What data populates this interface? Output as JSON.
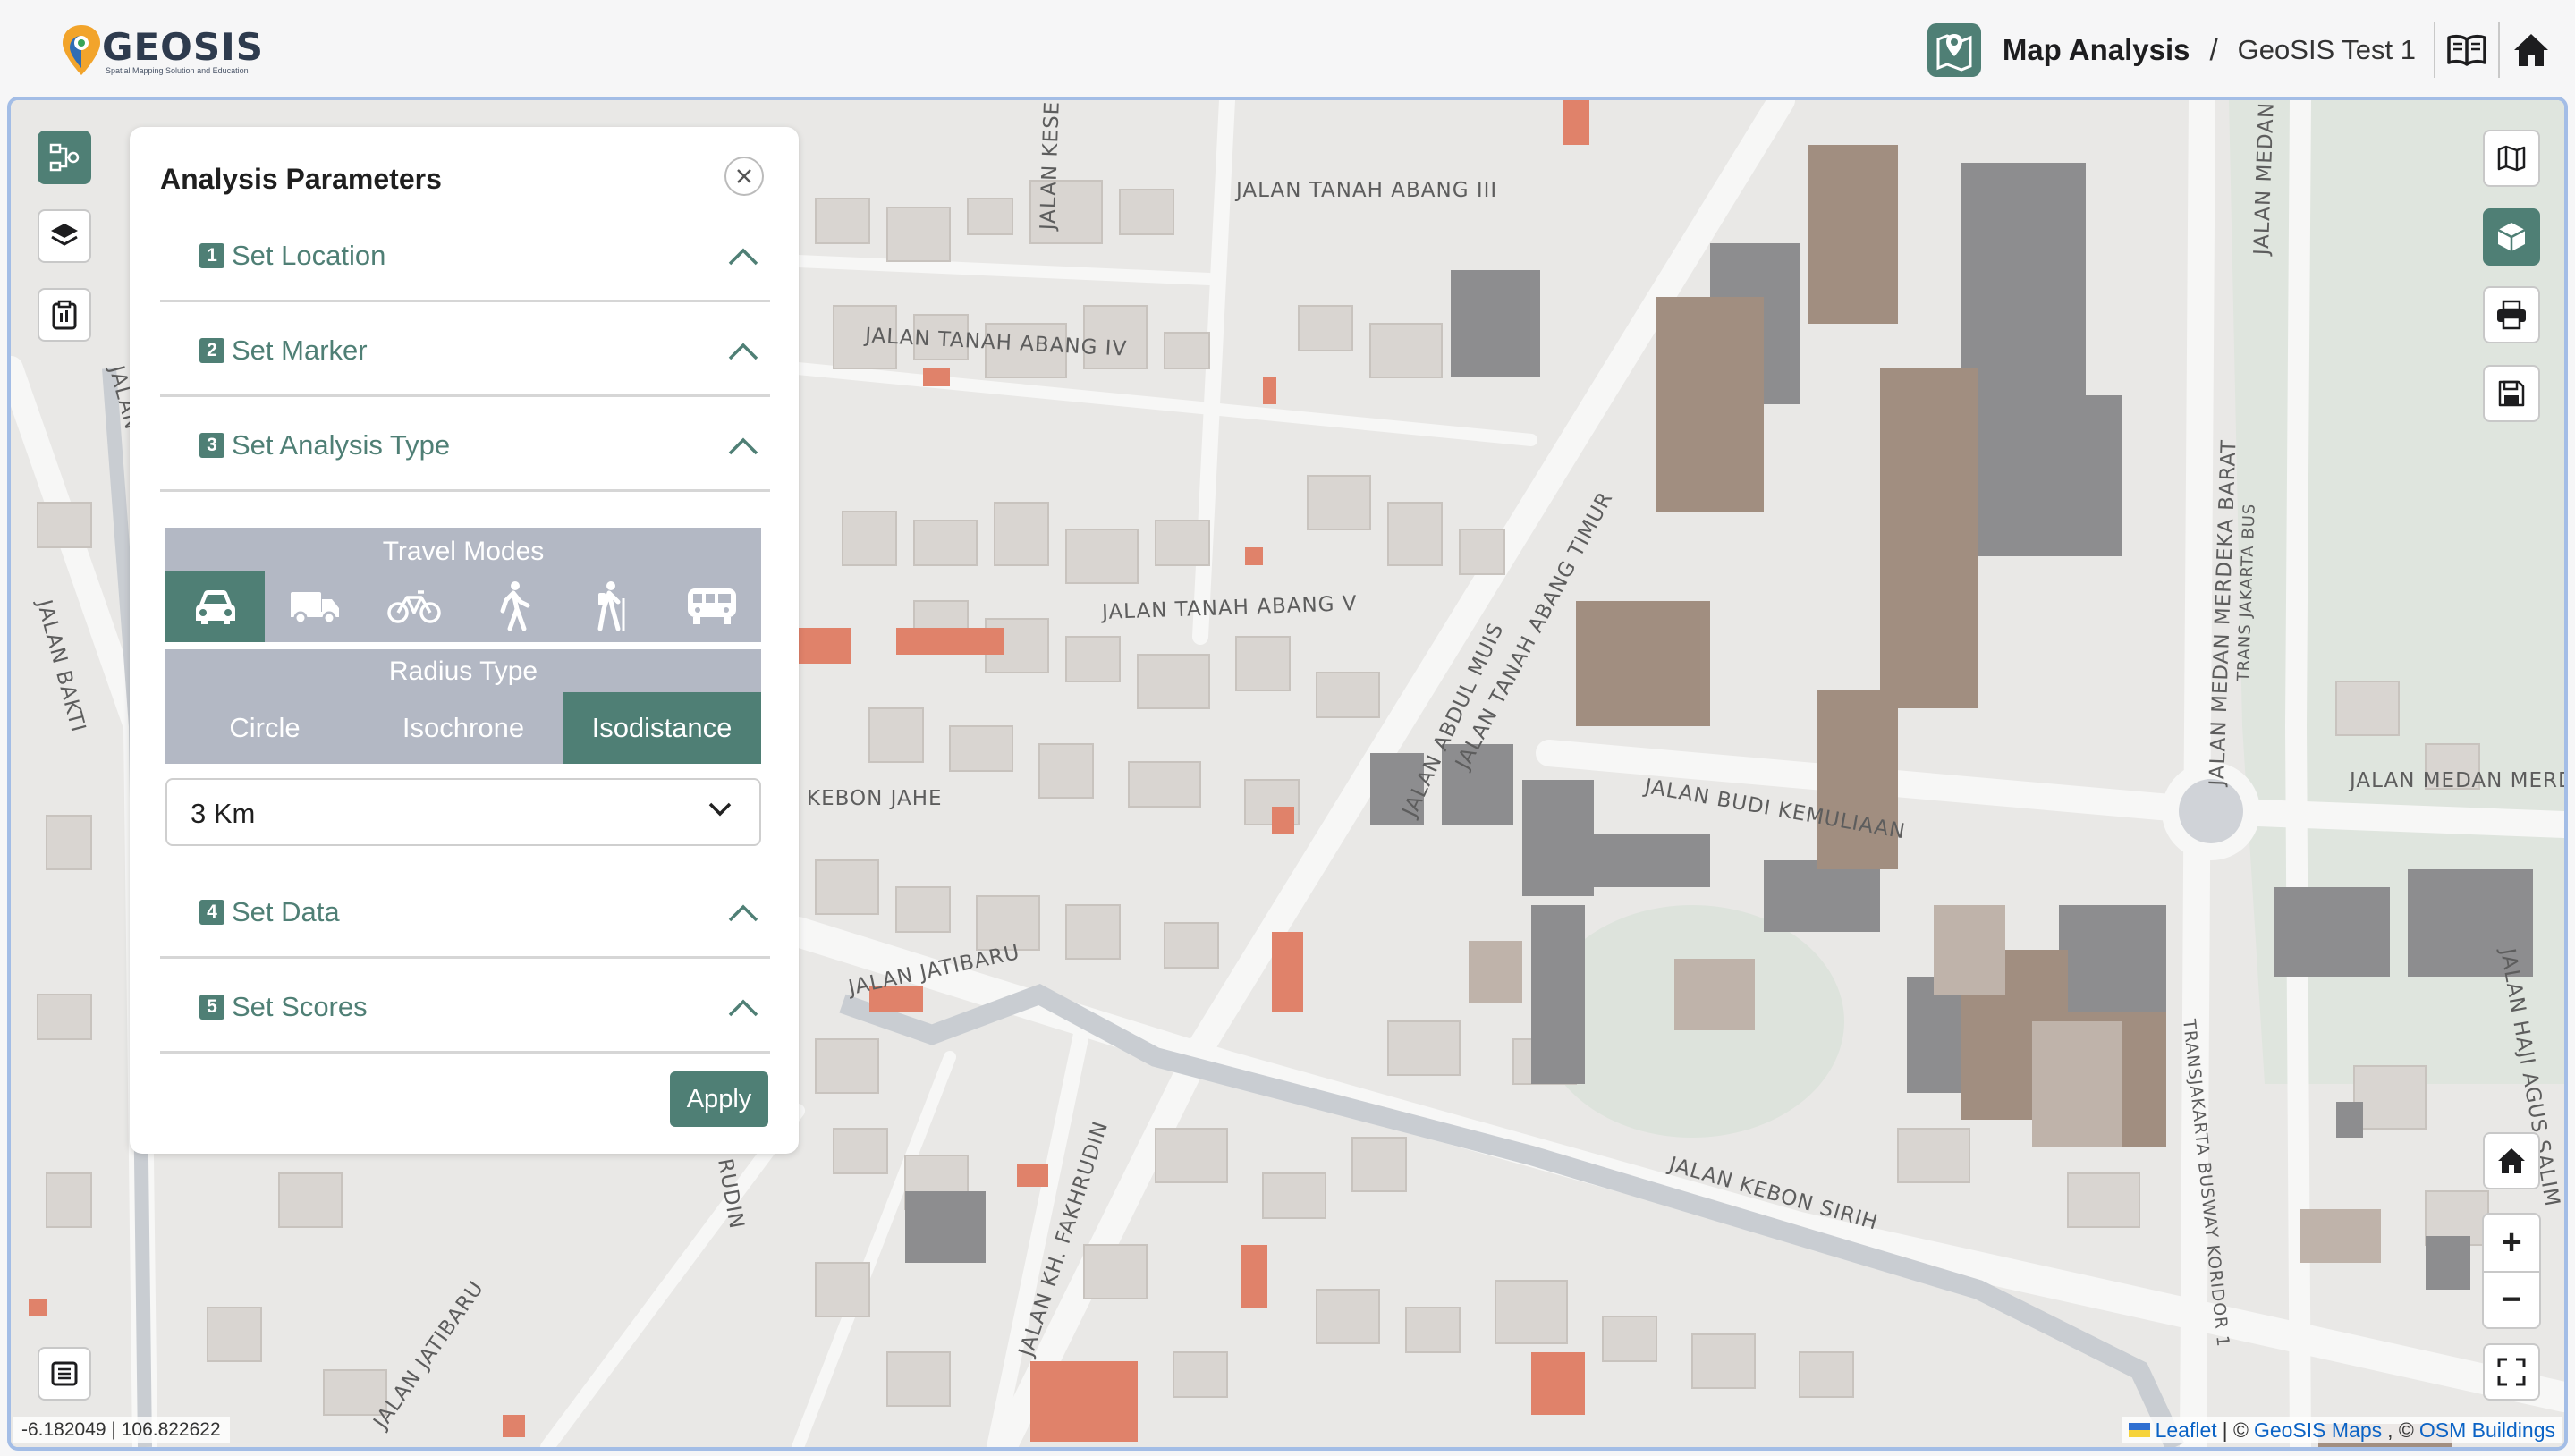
{
  "header": {
    "logo_text": "GEOSIS",
    "logo_tagline": "Spatial Mapping Solution and Education",
    "page_title": "Map Analysis",
    "separator": "/",
    "project_name": "GeoSIS Test 1"
  },
  "colors": {
    "accent": "#4f7f75",
    "panel_gray": "#b3b8c4",
    "map_bg": "#e9e8e6",
    "building_orange": "#e0826a"
  },
  "map": {
    "street_labels": [
      "JALAN TANAH ABANG III",
      "JALAN TANAH ABANG IV",
      "JALAN TANAH ABANG V",
      "JALAN ABDUL MUIS",
      "JALAN TANAH ABANG TIMUR",
      "JALAN MEDAN MERDEKA BARAT",
      "TRANS JAKARTA BUS",
      "JALAN MEDAN MERDEKA",
      "JALAN BUDI KEMULIAAN",
      "KEBON JAHE",
      "JALAN JATIBARU",
      "JALAN KH. FAKHRUDIN",
      "JALAN KEBON SIRIH",
      "TRANSJAKARTA BUSWAY KORIDOR 1",
      "JALAN HAJI AGUS SALIM",
      "JALAN BAKTI",
      "JALAN MEDAN M",
      "JALAN KESE",
      "JALAN",
      "JALAN JATIBARU",
      "RUDIN"
    ]
  },
  "panel": {
    "title": "Analysis Parameters",
    "steps": [
      {
        "num": "1",
        "label": "Set Location"
      },
      {
        "num": "2",
        "label": "Set Marker"
      },
      {
        "num": "3",
        "label": "Set Analysis Type"
      },
      {
        "num": "4",
        "label": "Set Data"
      },
      {
        "num": "5",
        "label": "Set Scores"
      }
    ],
    "travel_modes_title": "Travel Modes",
    "travel_modes": [
      "car",
      "truck",
      "bicycle",
      "walk",
      "hike",
      "bus"
    ],
    "selected_travel_mode": "car",
    "radius_type_title": "Radius Type",
    "radius_types": [
      "Circle",
      "Isochrone",
      "Isodistance"
    ],
    "selected_radius_type": "Isodistance",
    "distance_value": "3 Km",
    "apply_label": "Apply"
  },
  "footer": {
    "coordinates": "-6.182049 | 106.822622",
    "attribution_leaflet": "Leaflet",
    "attribution_sep1": "| ©",
    "attribution_geosis": "GeoSIS Maps",
    "attribution_sep2": ", ©",
    "attribution_osm": "OSM Buildings"
  },
  "controls": {
    "zoom_in": "+",
    "zoom_out": "−"
  }
}
